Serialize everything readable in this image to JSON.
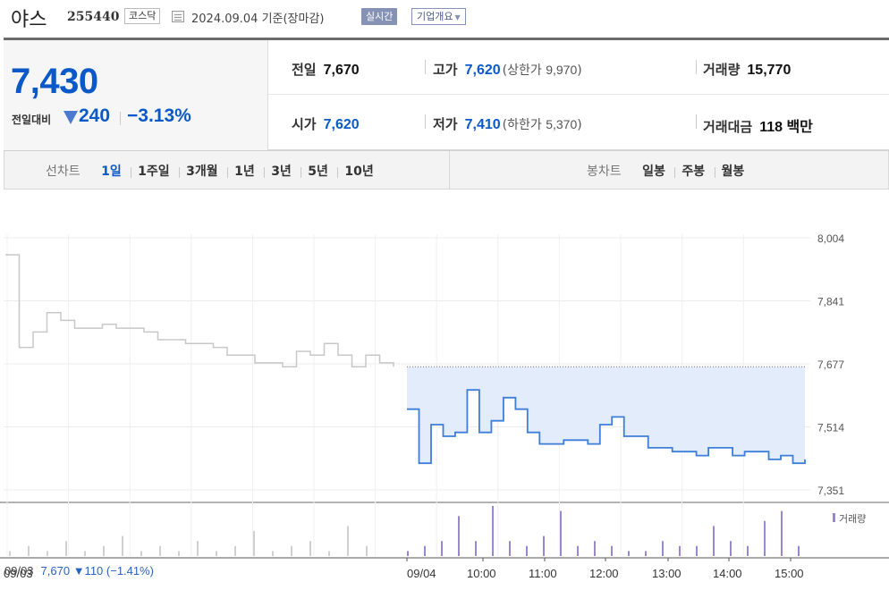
{
  "header": {
    "stock_name": "야스",
    "stock_code": "255440",
    "market": "코스닥",
    "date_text": "2024.09.04  기준(장마감)",
    "realtime_label": "실시간",
    "company_label": "기업개요",
    "icons": [
      "calendar-icon",
      "chevron-down-icon"
    ]
  },
  "summary": {
    "current_price": "7,430",
    "change_label": "전일대비",
    "change_value": "240",
    "change_pct": "−3.13%",
    "prev_close_label": "전일",
    "prev_close": "7,670",
    "high_label": "고가",
    "high": "7,620",
    "upper_limit_label": "상한가",
    "upper_limit": "9,970",
    "volume_label": "거래량",
    "volume": "15,770",
    "open_label": "시가",
    "open": "7,620",
    "low_label": "저가",
    "low": "7,410",
    "lower_limit_label": "하한가",
    "lower_limit": "5,370",
    "amount_label": "거래대금",
    "amount": "118 백만",
    "colors": {
      "down": "#0b59c8",
      "text": "#222222"
    }
  },
  "tabs": {
    "line_title": "선차트",
    "line_tabs": [
      "1일",
      "1주일",
      "3개월",
      "1년",
      "3년",
      "5년",
      "10년"
    ],
    "line_active": "1일",
    "candle_title": "봉차트",
    "candle_tabs": [
      "일봉",
      "주봉",
      "월봉"
    ]
  },
  "chart": {
    "volume_legend": "거래량",
    "prev_day_note": {
      "date": "09/03",
      "text": "7,670 ▼110 (−1.41%)"
    }
  },
  "chart_data": {
    "type": "line",
    "title": "",
    "y_ticks": [
      "8,004",
      "7,841",
      "7,677",
      "7,514",
      "7,351"
    ],
    "ylim": [
      7351,
      8004
    ],
    "x_ticks": [
      "09/03",
      "09/04",
      "10:00",
      "11:00",
      "12:00",
      "13:00",
      "14:00",
      "15:00"
    ],
    "reference_line": 7670,
    "series": [
      {
        "x": [
          0,
          1,
          2,
          3,
          4,
          5,
          6,
          7,
          8,
          9,
          10,
          11,
          12,
          13,
          14,
          15,
          16,
          17,
          18,
          19,
          20,
          21,
          22,
          23,
          24,
          25,
          26,
          27,
          28
        ],
        "values": [
          7960,
          7720,
          7760,
          7810,
          7790,
          7770,
          7770,
          7780,
          7770,
          7770,
          7760,
          7740,
          7740,
          7730,
          7730,
          7720,
          7700,
          7700,
          7680,
          7680,
          7670,
          7710,
          7700,
          7730,
          7700,
          7670,
          7700,
          7680,
          7670
        ]
      },
      {
        "x": [
          0,
          1,
          2,
          3,
          4,
          5,
          6,
          7,
          8,
          9,
          10,
          11,
          12,
          13,
          14,
          15,
          16,
          17,
          18,
          19,
          20,
          21,
          22,
          23,
          24,
          25,
          26,
          27,
          28,
          29,
          30,
          31,
          32,
          33
        ],
        "values": [
          7560,
          7420,
          7520,
          7490,
          7500,
          7610,
          7500,
          7530,
          7590,
          7560,
          7500,
          7470,
          7470,
          7480,
          7480,
          7470,
          7520,
          7540,
          7490,
          7490,
          7460,
          7460,
          7450,
          7450,
          7440,
          7460,
          7460,
          7440,
          7450,
          7450,
          7430,
          7440,
          7420,
          7430
        ]
      }
    ],
    "volume": [
      1,
      2,
      1,
      3,
      1,
      2,
      4,
      1,
      2,
      1,
      3,
      1,
      2,
      5,
      1,
      2,
      3,
      1,
      6,
      2,
      1,
      2,
      3,
      8,
      3,
      10,
      3,
      2,
      4,
      9,
      2,
      3,
      2,
      1,
      1,
      3,
      2,
      2,
      6,
      3,
      2,
      7,
      9,
      2
    ]
  }
}
